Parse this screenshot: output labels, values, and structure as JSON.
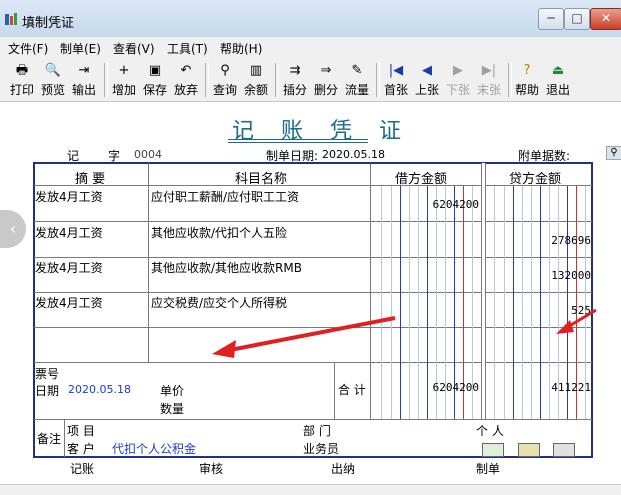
{
  "window": {
    "title": "填制凭证",
    "min": "─",
    "max": "□",
    "close": "✕"
  },
  "menu": [
    "文件(F)",
    "制单(E)",
    "查看(V)",
    "工具(T)",
    "帮助(H)"
  ],
  "toolbar": [
    {
      "label": "打印",
      "icon": "🖶"
    },
    {
      "label": "预览",
      "icon": "🔍"
    },
    {
      "label": "输出",
      "icon": "⇥"
    },
    {
      "label": "增加",
      "icon": "+"
    },
    {
      "label": "保存",
      "icon": "▣"
    },
    {
      "label": "放弃",
      "icon": "↶"
    },
    {
      "label": "查询",
      "icon": "⚲"
    },
    {
      "label": "余额",
      "icon": "▥"
    },
    {
      "label": "插分",
      "icon": "⇉"
    },
    {
      "label": "删分",
      "icon": "⇒"
    },
    {
      "label": "流量",
      "icon": "✎"
    },
    {
      "label": "首张",
      "icon": "|◀"
    },
    {
      "label": "上张",
      "icon": "◀"
    },
    {
      "label": "下张",
      "icon": "▶"
    },
    {
      "label": "末张",
      "icon": "▶|"
    },
    {
      "label": "帮助",
      "icon": "?"
    },
    {
      "label": "退出",
      "icon": "⏏"
    }
  ],
  "voucher": {
    "title": "记 账 凭 证",
    "type_label": "记",
    "no_label": "字",
    "no_value": "0004",
    "date_label": "制单日期:",
    "date_value": "2020.05.18",
    "attach_label": "附单据数:",
    "headers": {
      "summary": "摘 要",
      "account": "科目名称",
      "debit": "借方金额",
      "credit": "贷方金额"
    },
    "rows": [
      {
        "summary": "发放4月工资",
        "account": "应付职工薪酬/应付职工工资",
        "debit": "6204200",
        "credit": ""
      },
      {
        "summary": "发放4月工资",
        "account": "其他应收款/代扣个人五险",
        "debit": "",
        "credit": "278696"
      },
      {
        "summary": "发放4月工资",
        "account": "其他应收款/其他应收款RMB",
        "debit": "",
        "credit": "132000"
      },
      {
        "summary": "发放4月工资",
        "account": "应交税费/应交个人所得税",
        "debit": "",
        "credit": "525"
      }
    ],
    "ticket_label": "票号",
    "date2_label": "日期",
    "date2_value": "2020.05.18",
    "price_label": "单价",
    "qty_label": "数量",
    "total_label": "合 计",
    "debit_total": "6204200",
    "credit_total": "411221",
    "remark_label": "备注",
    "project_label": "项  目",
    "dept_label": "部  门",
    "person_label": "个  人",
    "customer_label": "客  户",
    "customer_value": "代扣个人公积金",
    "salesman_label": "业务员",
    "footer": {
      "bookkeeping": "记账",
      "audit": "审核",
      "cashier": "出纳",
      "maker": "制单"
    }
  }
}
